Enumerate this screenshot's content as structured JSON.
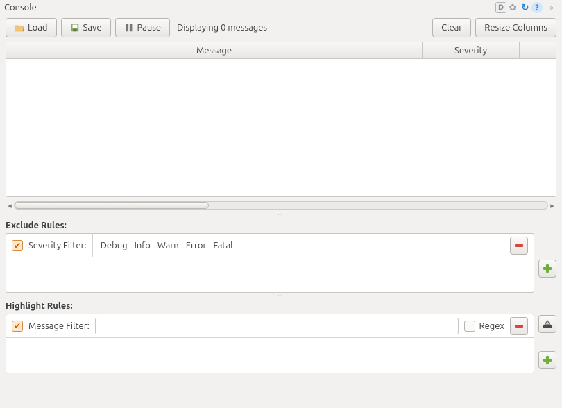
{
  "window": {
    "title": "Console"
  },
  "toolbar": {
    "load_label": "Load",
    "save_label": "Save",
    "pause_label": "Pause",
    "status_text": "Displaying 0 messages",
    "clear_label": "Clear",
    "resize_label": "Resize Columns"
  },
  "table": {
    "columns": {
      "message": "Message",
      "severity": "Severity"
    }
  },
  "chart_data": {
    "type": "table",
    "columns": [
      "Message",
      "Severity"
    ],
    "rows": []
  },
  "exclude": {
    "heading": "Exclude Rules:",
    "rule": {
      "enabled": true,
      "label": "Severity Filter:",
      "levels": [
        "Debug",
        "Info",
        "Warn",
        "Error",
        "Fatal"
      ]
    }
  },
  "highlight": {
    "heading": "Highlight Rules:",
    "rule": {
      "enabled": true,
      "label": "Message Filter:",
      "value": "",
      "regex_label": "Regex",
      "regex_checked": false
    }
  }
}
